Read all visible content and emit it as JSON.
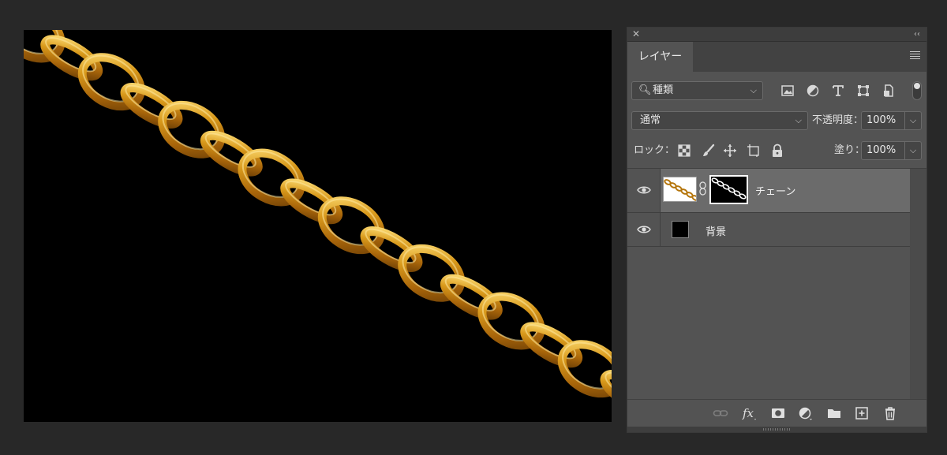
{
  "panel": {
    "close_glyph": "✕",
    "collapse_glyph": "‹‹",
    "tab_label": "レイヤー",
    "menu_icon": "hamburger-icon"
  },
  "filter": {
    "kind_label": "種類",
    "icons": [
      "image-filter-icon",
      "adjustment-filter-icon",
      "type-filter-icon",
      "shape-filter-icon",
      "smart-object-filter-icon"
    ],
    "toggle_on": true
  },
  "blend": {
    "mode": "通常",
    "opacity_label": "不透明度：",
    "opacity_value": "100%"
  },
  "lock": {
    "label": "ロック：",
    "icons": [
      "lock-transparent-pixels-icon",
      "lock-image-pixels-icon",
      "lock-position-icon",
      "lock-artboard-icon",
      "lock-all-icon"
    ],
    "fill_label": "塗り：",
    "fill_value": "100%"
  },
  "layers": [
    {
      "name": "チェーン",
      "visible": true,
      "selected": true,
      "has_mask": true
    },
    {
      "name": "背景",
      "visible": true,
      "selected": false,
      "has_mask": false
    }
  ],
  "footer_icons": [
    "link-layers-icon",
    "fx-icon",
    "add-mask-icon",
    "adjustment-layer-icon",
    "new-group-icon",
    "new-layer-icon",
    "trash-icon"
  ],
  "colors": {
    "chain_gold": "#c98a12",
    "chain_highlight": "#ffe07a",
    "chain_shadow": "#6b3e05",
    "canvas_bg": "#000000",
    "selected_row": "#6b6b6b"
  }
}
